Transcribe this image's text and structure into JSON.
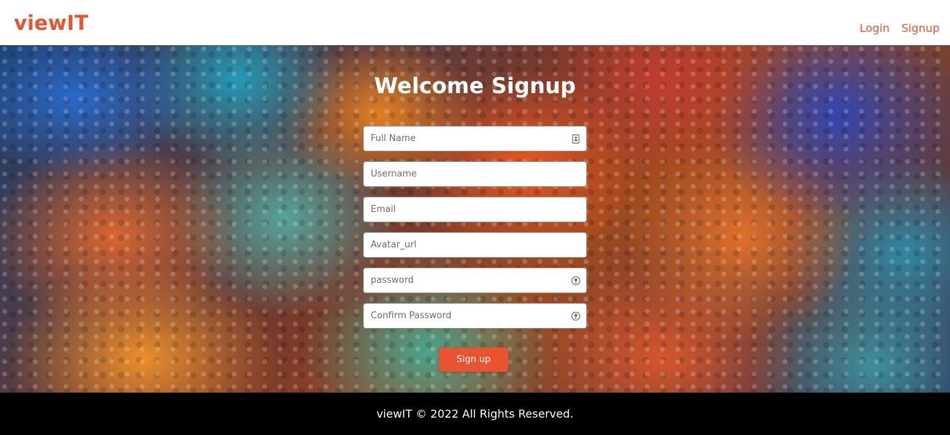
{
  "header": {
    "logo": "viewIT",
    "nav": {
      "login": "Login",
      "signup": "Signup"
    }
  },
  "form": {
    "title": "Welcome Signup",
    "fields": {
      "full_name": {
        "placeholder": "Full Name",
        "icon": "contact-card-icon"
      },
      "username": {
        "placeholder": "Username"
      },
      "email": {
        "placeholder": "Email"
      },
      "avatar_url": {
        "placeholder": "Avatar_url"
      },
      "password": {
        "placeholder": "password",
        "icon": "key-icon"
      },
      "confirm_password": {
        "placeholder": "Confirm Password",
        "icon": "key-icon"
      }
    },
    "submit_label": "Sign up"
  },
  "footer": {
    "text": "viewIT © 2022 All Rights Reserved."
  },
  "colors": {
    "accent": "#e9532f",
    "footer_bg": "#000000",
    "header_bg": "#ffffff"
  }
}
